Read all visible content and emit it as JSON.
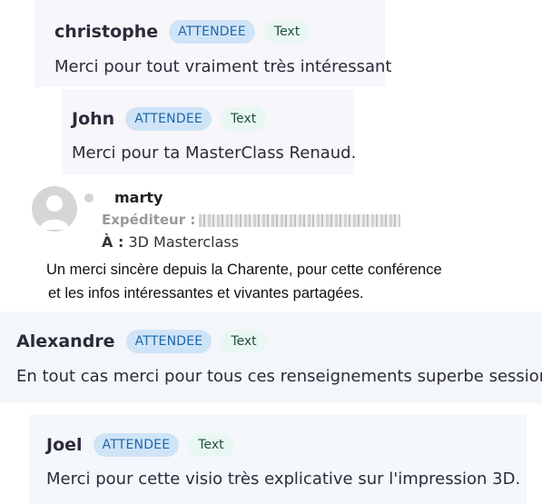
{
  "comments": [
    {
      "name": "christophe",
      "badge": "ATTENDEE",
      "tag": "Text",
      "message": "Merci pour tout vraiment très intéressant"
    },
    {
      "name": "John",
      "badge": "ATTENDEE",
      "tag": "Text",
      "message": "Merci pour ta MasterClass Renaud."
    },
    {
      "name": "Alexandre",
      "badge": "ATTENDEE",
      "tag": "Text",
      "message": "En tout cas merci pour tous ces renseignements superbe session"
    },
    {
      "name": "Joel",
      "badge": "ATTENDEE",
      "tag": "Text",
      "message": "Merci pour cette visio très explicative sur l'impression 3D."
    }
  ],
  "email": {
    "sender_name": "marty",
    "from_label": "Expéditeur :",
    "to_label": "À :",
    "to_value": "3D Masterclass",
    "body_lines": [
      "Un merci sincère depuis la Charente, pour cette conférence",
      "et les infos intéressantes et vivantes partagées."
    ],
    "avatar_icon": "user-avatar-icon"
  },
  "colors": {
    "badge_bg": "#cfe4f7",
    "badge_text": "#1e67a8",
    "tag_bg": "#e9f7f2"
  }
}
